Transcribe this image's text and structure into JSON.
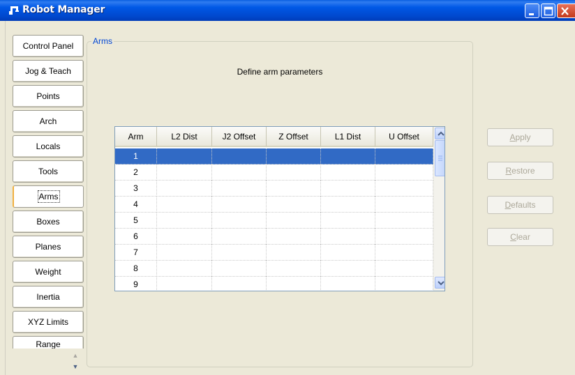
{
  "window": {
    "title": "Robot Manager",
    "icon": "robot-arm-icon"
  },
  "tabs": [
    {
      "label": "Control Panel"
    },
    {
      "label": "Jog & Teach"
    },
    {
      "label": "Points"
    },
    {
      "label": "Arch"
    },
    {
      "label": "Locals"
    },
    {
      "label": "Tools"
    },
    {
      "label": "Arms",
      "active": true
    },
    {
      "label": "Boxes"
    },
    {
      "label": "Planes"
    },
    {
      "label": "Weight"
    },
    {
      "label": "Inertia"
    },
    {
      "label": "XYZ Limits"
    },
    {
      "label": "Range"
    }
  ],
  "group": {
    "label": "Arms",
    "subtitle": "Define arm parameters"
  },
  "table": {
    "columns": [
      "Arm",
      "L2 Dist",
      "J2 Offset",
      "Z Offset",
      "L1 Dist",
      "U Offset"
    ],
    "rows": [
      {
        "arm": "1",
        "selected": true
      },
      {
        "arm": "2"
      },
      {
        "arm": "3"
      },
      {
        "arm": "4"
      },
      {
        "arm": "5"
      },
      {
        "arm": "6"
      },
      {
        "arm": "7"
      },
      {
        "arm": "8"
      },
      {
        "arm": "9"
      }
    ]
  },
  "actions": [
    {
      "label_pre": "",
      "accel": "A",
      "label_post": "pply"
    },
    {
      "label_pre": "",
      "accel": "R",
      "label_post": "estore"
    },
    {
      "label_pre": "",
      "accel": "D",
      "label_post": "efaults"
    },
    {
      "label_pre": "",
      "accel": "C",
      "label_post": "lear"
    }
  ],
  "colors": {
    "selection": "#316ac5",
    "group_label": "#0046d5",
    "active_tab_accent": "#f0b040"
  }
}
